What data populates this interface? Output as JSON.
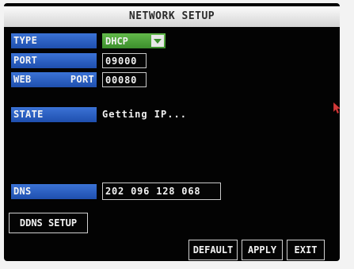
{
  "window": {
    "title": "NETWORK SETUP"
  },
  "fields": {
    "type": {
      "label": "TYPE",
      "value": "DHCP"
    },
    "port": {
      "label": "PORT",
      "value": "09000"
    },
    "web_port": {
      "label_part1": "WEB",
      "label_part2": "PORT",
      "value": "00080"
    },
    "state": {
      "label": "STATE",
      "value": "Getting IP..."
    },
    "dns": {
      "label": "DNS",
      "value": "202 096 128 068"
    }
  },
  "buttons": {
    "ddns_setup": "DDNS SETUP",
    "default": "DEFAULT",
    "apply": "APPLY",
    "exit": "EXIT"
  },
  "icons": {
    "dropdown": "chevron-down-icon",
    "cursor": "mouse-cursor-icon"
  },
  "colors": {
    "label_bg": "#2a5cc4",
    "dropdown_bg": "#4ea63b",
    "title_bg": "#e6e6e6",
    "screen_bg": "#030303",
    "cursor": "#d23a3a"
  }
}
